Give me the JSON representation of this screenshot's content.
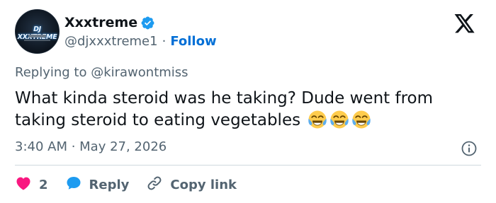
{
  "author": {
    "display_name": "Xxxtreme",
    "handle": "@djxxxtreme1",
    "avatar_logo_text": "DJ XXXTREME",
    "verified": true
  },
  "follow_label": "Follow",
  "separator": "·",
  "reply_context": "Replying to @kirawontmiss",
  "tweet": {
    "text": "What kinda steroid was he taking? Dude went from taking steroid to eating vegetables",
    "emojis": [
      "face-with-tears-of-joy-icon",
      "face-with-tears-of-joy-icon",
      "face-with-tears-of-joy-icon"
    ]
  },
  "timestamp": "3:40 AM · May 27, 2026",
  "actions": {
    "like_count": "2",
    "reply_label": "Reply",
    "copy_link_label": "Copy link"
  },
  "colors": {
    "text": "#0f1419",
    "secondary": "#536471",
    "link": "#006fd6",
    "like": "#f91880",
    "reply": "#1d9bf0",
    "divider": "#cfd9de",
    "verified": "#1d9bf0"
  }
}
